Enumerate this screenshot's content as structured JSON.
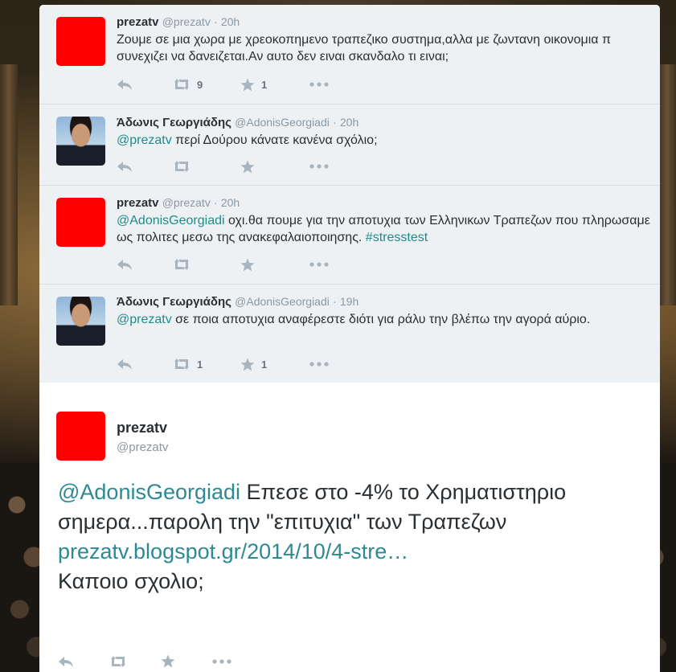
{
  "tweets": [
    {
      "fullname": "prezatv",
      "username": "@prezatv",
      "dot": "·",
      "time": "20h",
      "text": "Ζουμε σε μια χωρα με χρεοκοπημενο τραπεζικο συστημα,αλλα με ζωντανη οικονομια π συνεχιζει να δανειζεται.Αν αυτο δεν ειναι σκανδαλο τι ειναι;",
      "retweets": "9",
      "favorites": "1"
    },
    {
      "fullname": "Άδωνις Γεωργιάδης",
      "username": "@AdonisGeorgiadi",
      "dot": "·",
      "time": "20h",
      "mention": "@prezatv",
      "text": " περί Δούρου κάνατε κανένα σχόλιο;",
      "retweets": "",
      "favorites": ""
    },
    {
      "fullname": "prezatv",
      "username": "@prezatv",
      "dot": "·",
      "time": "20h",
      "mention": "@AdonisGeorgiadi",
      "text": " οχι.θα πουμε για την αποτυχια των Ελληνικων Τραπεζων που πληρωσαμε ως πολιτες μεσω της  ανακεφαλαιοποιησης. ",
      "hashtag": "#stresstest",
      "retweets": "",
      "favorites": ""
    },
    {
      "fullname": "Άδωνις Γεωργιάδης",
      "username": "@AdonisGeorgiadi",
      "dot": "·",
      "time": "19h",
      "mention": "@prezatv",
      "text": " σε ποια αποτυχια αναφέρεστε διότι για ράλυ την βλέπω την αγορά αύριο.",
      "retweets": "1",
      "favorites": "1"
    }
  ],
  "expanded": {
    "fullname": "prezatv",
    "username": "@prezatv",
    "mention": "@AdonisGeorgiadi",
    "text1": " Επεσε στο -4% το Χρηματιστηριο σημερα...παρολη την \"επιτυχια\" των Τραπεζων ",
    "link": "prezatv.blogspot.gr/2014/10/4-stre…",
    "text2": "Καποιο σχολιο;"
  },
  "icons": [
    "reply-icon",
    "retweet-icon",
    "favorite-icon",
    "more-icon"
  ],
  "colors": {
    "link": "#1f8b8b",
    "avatar_red": "#ff0000",
    "icon_gray": "#a8b5be"
  }
}
